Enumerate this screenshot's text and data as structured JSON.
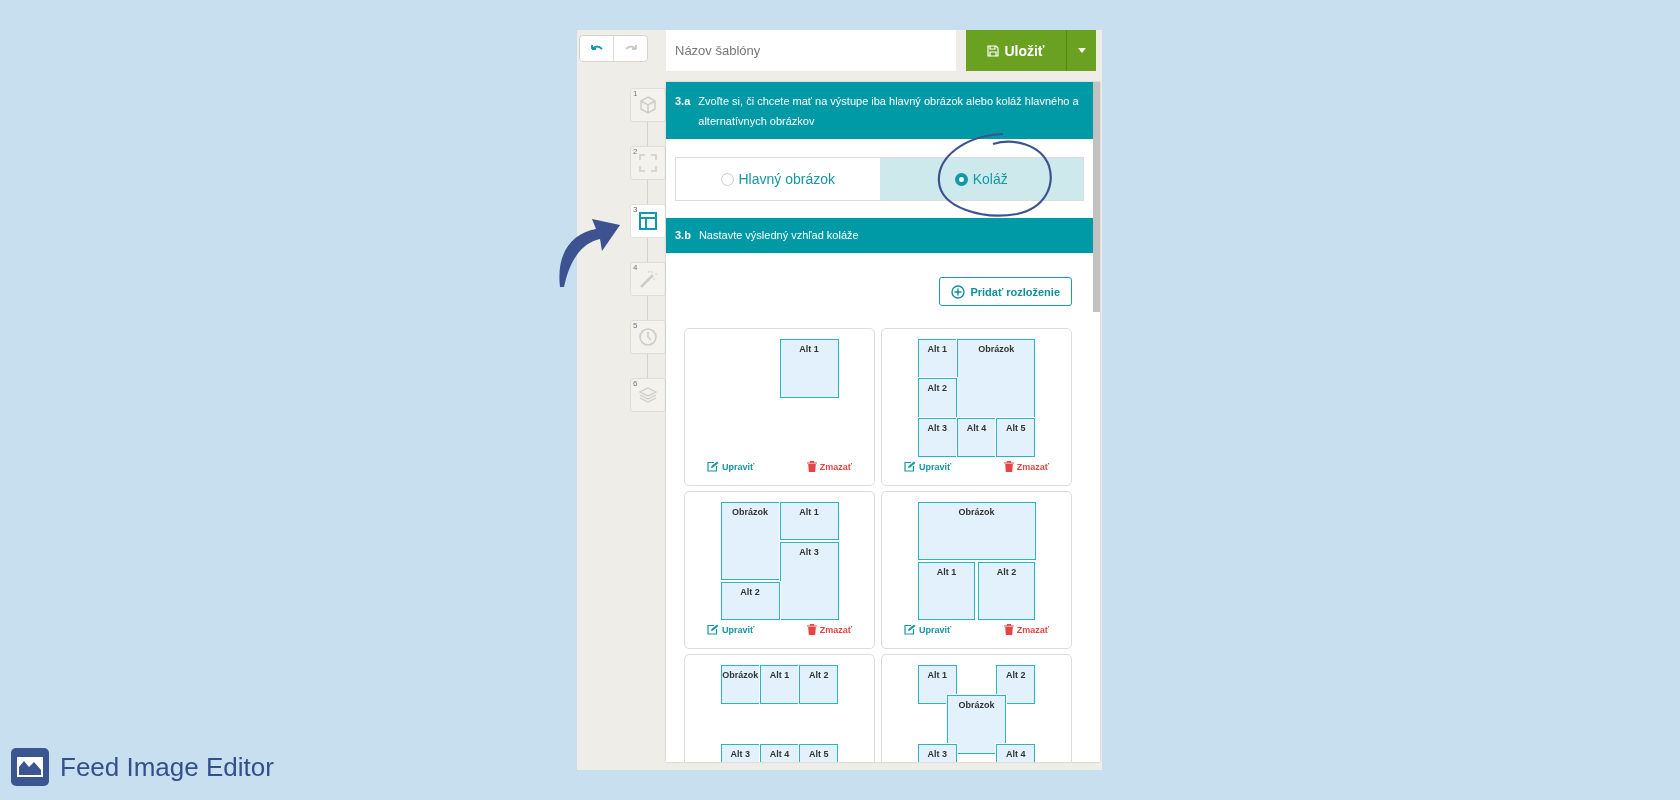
{
  "toolbar": {
    "undo_disabled": false,
    "redo_disabled": true
  },
  "template_name": {
    "placeholder": "Názov šablóny"
  },
  "save_button": {
    "label": "Uložiť"
  },
  "steps": [
    {
      "number": "1",
      "selected": false,
      "kind": "cube"
    },
    {
      "number": "2",
      "selected": false,
      "kind": "frame"
    },
    {
      "number": "3",
      "selected": true,
      "kind": "layout"
    },
    {
      "number": "4",
      "selected": false,
      "kind": "wand"
    },
    {
      "number": "5",
      "selected": false,
      "kind": "clock"
    },
    {
      "number": "6",
      "selected": false,
      "kind": "layers"
    }
  ],
  "section_a": {
    "number": "3.a",
    "title": "Zvoľte si, či chcete mať na výstupe iba hlavný obrázok alebo koláž hlavného a alternatívnych obrázkov",
    "options": [
      {
        "label": "Hlavný obrázok",
        "selected": false
      },
      {
        "label": "Koláž",
        "selected": true
      }
    ]
  },
  "section_b": {
    "number": "3.b",
    "title": "Nastavte výsledný vzhľad koláže",
    "add_button": "Pridať rozloženie",
    "layouts": [
      {
        "kind": "corner",
        "tiles": [
          "Alt 1"
        ],
        "edit": "Upraviť",
        "delete": "Zmazať"
      },
      {
        "kind": "main-top-right",
        "tiles": [
          "Alt 1",
          "Obrázok",
          "Alt 2",
          "Alt 3",
          "Alt 4",
          "Alt 5"
        ],
        "edit": "Upraviť",
        "delete": "Zmazať"
      },
      {
        "kind": "two-columns",
        "tiles": [
          "Obrázok",
          "Alt 1",
          "Alt 3",
          "Alt 2"
        ],
        "edit": "Upraviť",
        "delete": "Zmazať"
      },
      {
        "kind": "main-top",
        "tiles": [
          "Obrázok",
          "Alt 1",
          "Alt 2"
        ],
        "edit": "Upraviť",
        "delete": "Zmazať"
      },
      {
        "kind": "two-rows",
        "tiles": [
          "Obrázok",
          "Alt 1",
          "Alt 2",
          "Alt 3",
          "Alt 4",
          "Alt 5"
        ]
      },
      {
        "kind": "main-center",
        "tiles": [
          "Alt 1",
          "Alt 2",
          "Obrázok",
          "Alt 3",
          "Alt 4"
        ]
      }
    ]
  },
  "brand": {
    "name": "Feed Image Editor"
  }
}
